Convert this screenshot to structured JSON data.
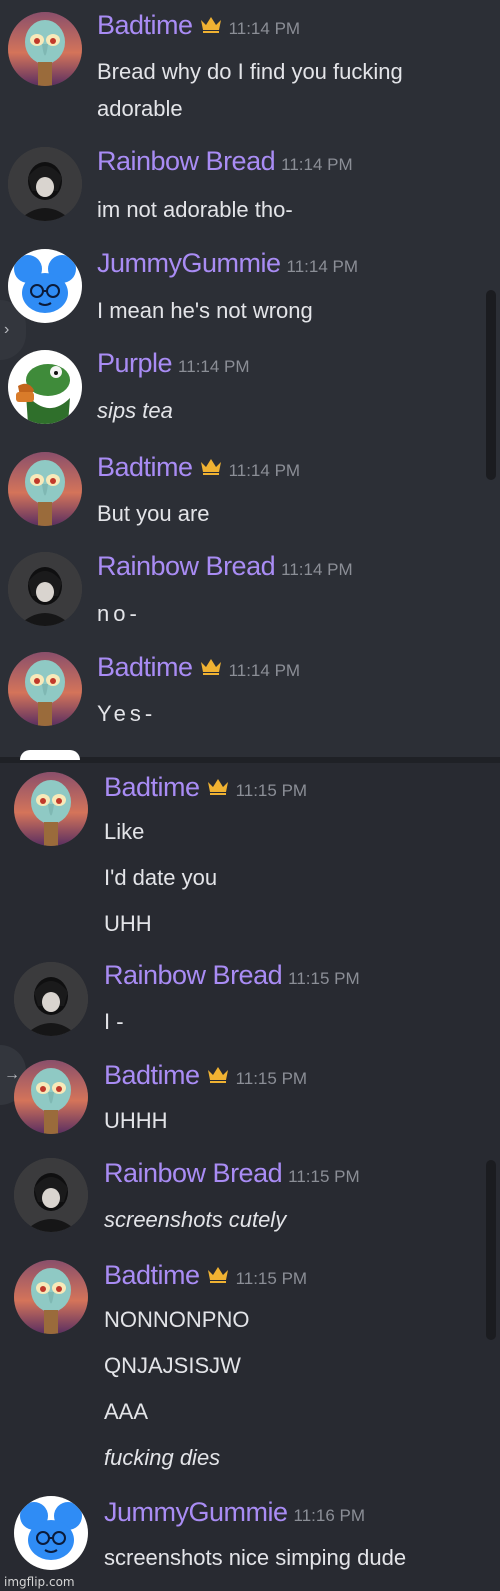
{
  "colors": {
    "username": "#a98cf4",
    "timestamp": "#8b8e96",
    "text": "#e3e4e8",
    "crown": "#f0b232",
    "background": "#2c2f36"
  },
  "messages": [
    {
      "user": "Badtime",
      "time": "11:14 PM",
      "crown": true,
      "avatar": "squidward-avatar",
      "lines": [
        "Bread why do I find you fucking",
        "adorable"
      ]
    },
    {
      "user": "Rainbow Bread",
      "time": "11:14 PM",
      "crown": false,
      "avatar": "dark-hair-avatar",
      "lines": [
        "im not adorable tho-"
      ]
    },
    {
      "user": "JummyGummie",
      "time": "11:14 PM",
      "crown": false,
      "avatar": "blue-mouse-avatar",
      "lines": [
        "I mean he's not wrong"
      ]
    },
    {
      "user": "Purple",
      "time": "11:14 PM",
      "crown": false,
      "avatar": "kermit-tea-avatar",
      "lines": [
        "sips tea"
      ]
    },
    {
      "user": "Badtime",
      "time": "11:14 PM",
      "crown": true,
      "avatar": "squidward-avatar",
      "lines": [
        "But you are"
      ]
    },
    {
      "user": "Rainbow Bread",
      "time": "11:14 PM",
      "crown": false,
      "avatar": "dark-hair-avatar",
      "lines": [
        "no-"
      ]
    },
    {
      "user": "Badtime",
      "time": "11:14 PM",
      "crown": true,
      "avatar": "squidward-avatar",
      "lines": [
        "Yes-"
      ]
    },
    {
      "user": "Badtime",
      "time": "11:15 PM",
      "crown": true,
      "avatar": "squidward-avatar",
      "lines": [
        "Like",
        "I'd date you",
        "UHH"
      ]
    },
    {
      "user": "Rainbow Bread",
      "time": "11:15 PM",
      "crown": false,
      "avatar": "dark-hair-avatar",
      "lines": [
        "I -"
      ]
    },
    {
      "user": "Badtime",
      "time": "11:15 PM",
      "crown": true,
      "avatar": "squidward-avatar",
      "lines": [
        "UHHH"
      ]
    },
    {
      "user": "Rainbow Bread",
      "time": "11:15 PM",
      "crown": false,
      "avatar": "dark-hair-avatar",
      "lines": [
        "screenshots cutely"
      ]
    },
    {
      "user": "Badtime",
      "time": "11:15 PM",
      "crown": true,
      "avatar": "squidward-avatar",
      "lines": [
        "NONNONPNO",
        "QNJAJSISJW",
        "AAA",
        "fucking dies"
      ]
    },
    {
      "user": "JummyGummie",
      "time": "11:16 PM",
      "crown": false,
      "avatar": "blue-mouse-avatar",
      "lines": [
        "screenshots nice simping dude"
      ]
    }
  ],
  "watermark": "imgflip.com"
}
